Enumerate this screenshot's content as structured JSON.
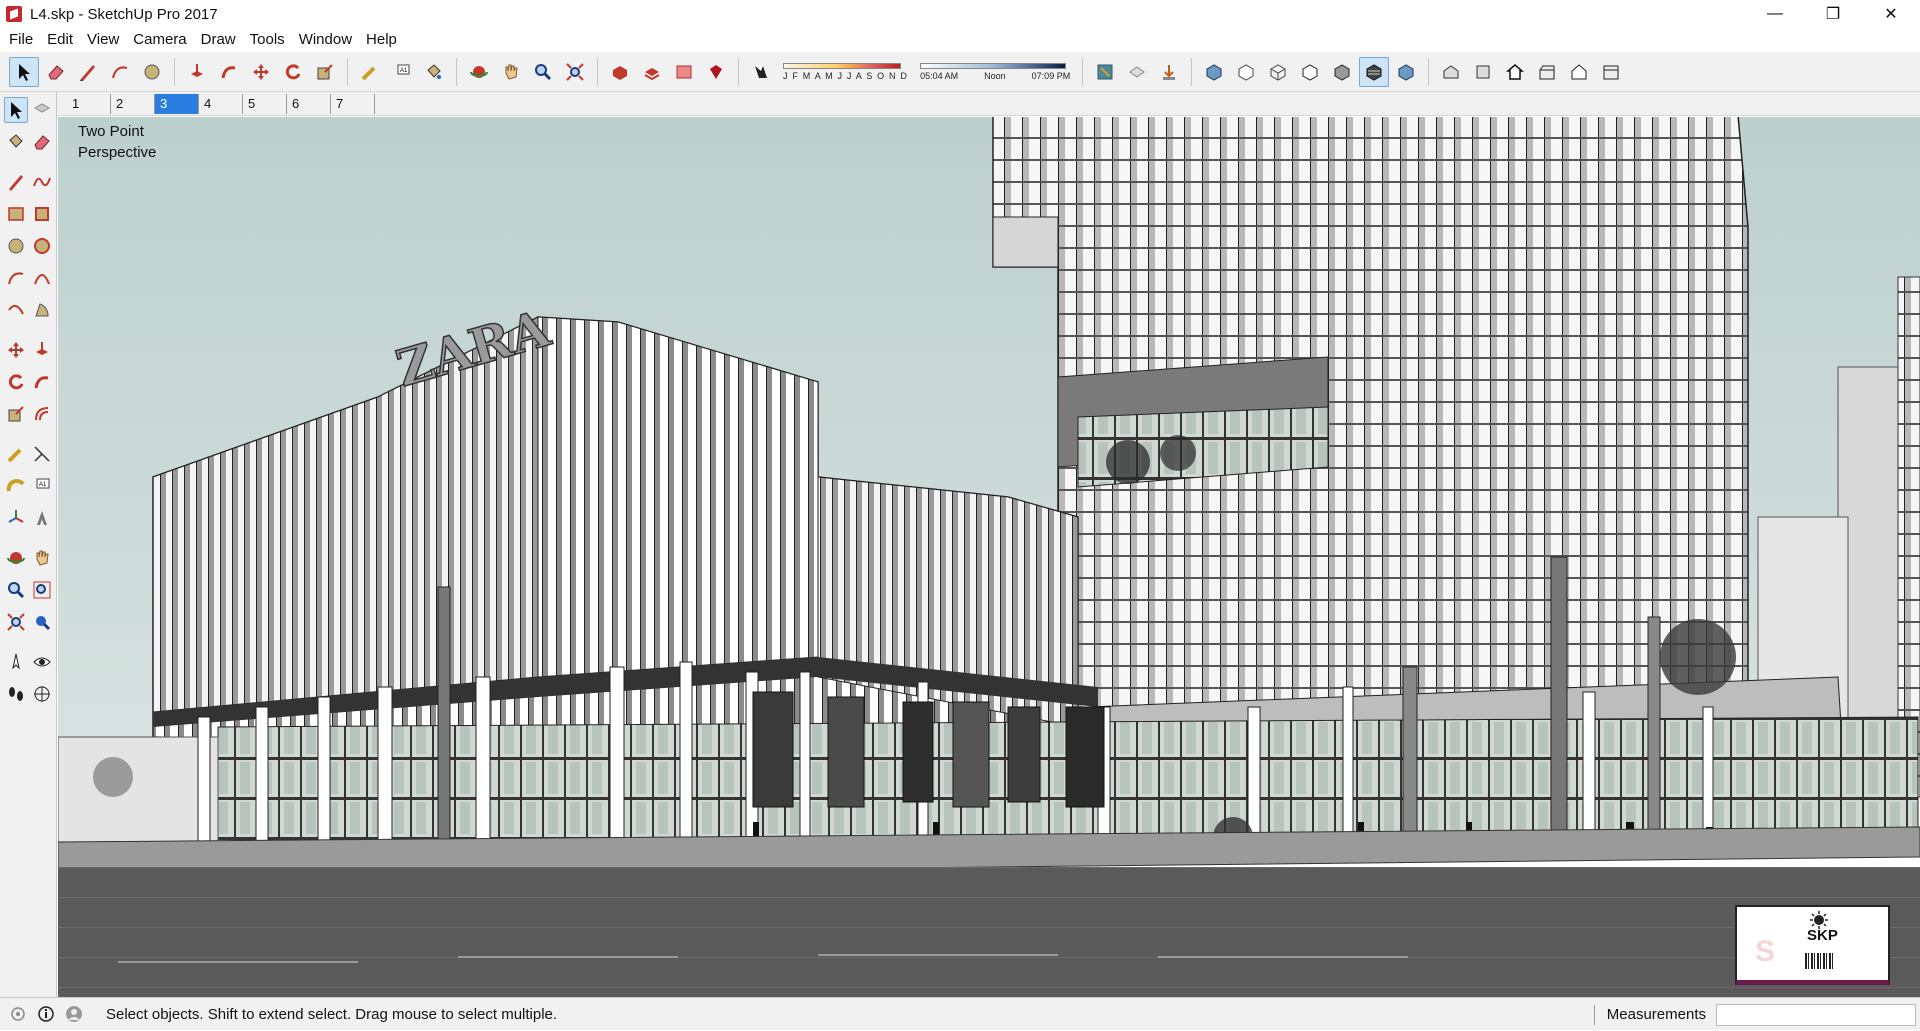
{
  "window": {
    "title": "L4.skp - SketchUp Pro 2017",
    "controls": {
      "minimize": "—",
      "restore": "❐",
      "close": "✕"
    }
  },
  "menu": [
    "File",
    "Edit",
    "View",
    "Camera",
    "Draw",
    "Tools",
    "Window",
    "Help"
  ],
  "toolbar": {
    "shadow_months": "J F M A M J J A S O N D",
    "time_start": "05:04 AM",
    "time_mid": "Noon",
    "time_end": "07:09 PM"
  },
  "scenes": {
    "tabs": [
      "1",
      "2",
      "3",
      "4",
      "5",
      "6",
      "7"
    ],
    "active": "3"
  },
  "viewport": {
    "camera_label": "Two Point\nPerspective",
    "signage": "ZARA"
  },
  "badge": {
    "logo_text": "SKP",
    "ghost_text": "S"
  },
  "status": {
    "text": "Select objects. Shift to extend select. Drag mouse to select multiple.",
    "measurements_label": "Measurements",
    "measurements_value": ""
  },
  "colors": {
    "sky": "#c9d9d6",
    "accent": "#2b7de1",
    "brand": "#c8282d"
  }
}
